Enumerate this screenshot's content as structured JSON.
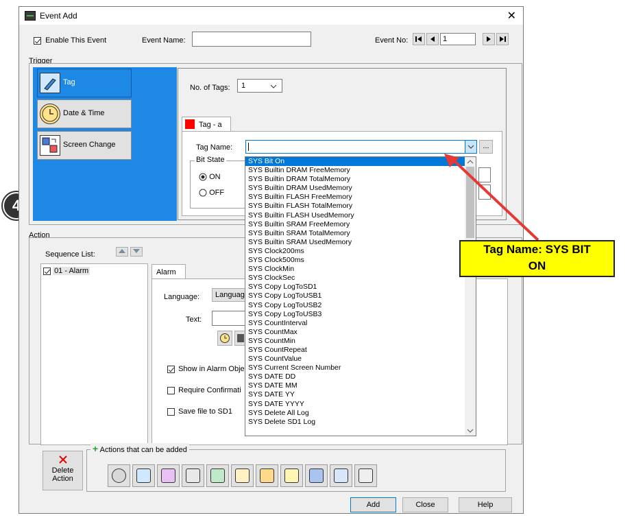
{
  "window": {
    "title": "Event Add",
    "close": "✕"
  },
  "top": {
    "enable_label": "Enable This Event",
    "event_name_label": "Event Name:",
    "event_name_value": "",
    "event_no_label": "Event No:",
    "event_no_value": "1"
  },
  "trigger": {
    "section_label": "Trigger",
    "buttons": [
      {
        "label": "Tag",
        "icon": "tag-icon",
        "selected": true
      },
      {
        "label": "Date & Time",
        "icon": "clock-icon",
        "selected": false
      },
      {
        "label": "Screen Change",
        "icon": "screen-change-icon",
        "selected": false
      }
    ],
    "no_of_tags_label": "No. of Tags:",
    "no_of_tags_value": "1",
    "tag_tab_label": "Tag - a",
    "tag_name_label": "Tag Name:",
    "tag_name_value": "",
    "browse_label": "...",
    "bit_state_label": "Bit State",
    "on_label": "ON",
    "off_label": "OFF"
  },
  "dropdown": {
    "selected": "SYS Bit On",
    "items": [
      "SYS Bit On",
      "SYS Builtin DRAM FreeMemory",
      "SYS Builtin DRAM TotalMemory",
      "SYS Builtin DRAM UsedMemory",
      "SYS Builtin FLASH FreeMemory",
      "SYS Builtin FLASH TotalMemory",
      "SYS Builtin FLASH UsedMemory",
      "SYS Builtin SRAM FreeMemory",
      "SYS Builtin SRAM TotalMemory",
      "SYS Builtin SRAM UsedMemory",
      "SYS Clock200ms",
      "SYS Clock500ms",
      "SYS ClockMin",
      "SYS ClockSec",
      "SYS Copy LogToSD1",
      "SYS Copy LogToUSB1",
      "SYS Copy LogToUSB2",
      "SYS Copy LogToUSB3",
      "SYS CountInterval",
      "SYS CountMax",
      "SYS CountMin",
      "SYS CountRepeat",
      "SYS CountValue",
      "SYS Current Screen Number",
      "SYS DATE DD",
      "SYS DATE MM",
      "SYS DATE YY",
      "SYS DATE YYYY",
      "SYS Delete All Log",
      "SYS Delete SD1 Log"
    ]
  },
  "action": {
    "section_label": "Action",
    "sequence_list_label": "Sequence List:",
    "sequence_item": "01 - Alarm",
    "alarm_tab_label": "Alarm",
    "language_label": "Language:",
    "language_value": "Languag",
    "text_label": "Text:",
    "show_in_alarm_label": "Show in Alarm Obje",
    "require_confirm_label": "Require Confirmati",
    "save_file_label": "Save file to SD1",
    "actions_can_add_label": "Actions that can be added",
    "delete_action_label_1": "Delete",
    "delete_action_label_2": "Action",
    "toolbar_icons": [
      "alarm-icon",
      "tag-write-icon",
      "tag-copy-icon",
      "sound-icon",
      "screen-capture-icon",
      "email-icon",
      "file-icon",
      "effect-icon",
      "screen-change-icon",
      "window-icon",
      "calculator-icon"
    ]
  },
  "footer": {
    "add": "Add",
    "close": "Close",
    "help": "Help"
  },
  "annotation": {
    "callout_line1": "Tag Name: SYS BIT",
    "callout_line2": "ON",
    "step_number": "4"
  },
  "colors": {
    "selected_blue": "#1e88e5",
    "list_highlight": "#0078d7",
    "callout_yellow": "#ffff00",
    "arrow_red": "#e53935",
    "tag_red": "#ff0000"
  }
}
